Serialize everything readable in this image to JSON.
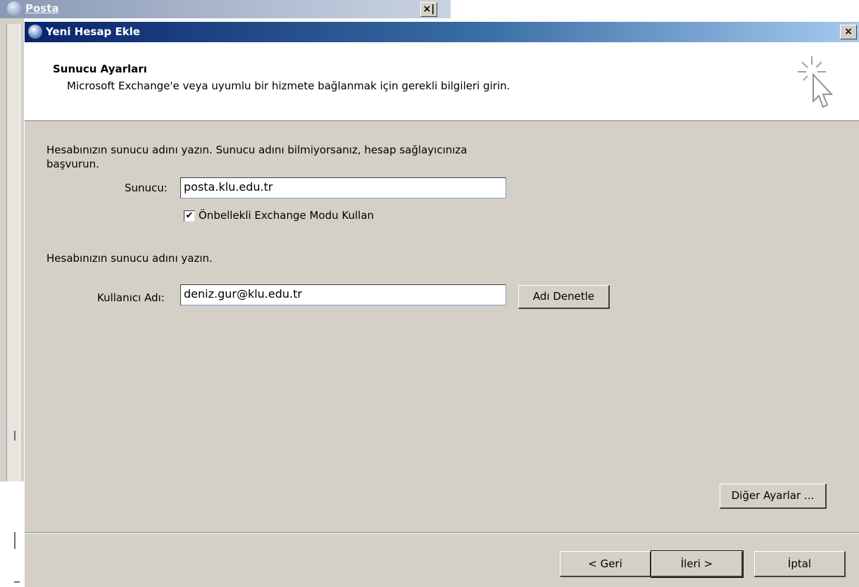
{
  "background_window": {
    "title": "Posta",
    "close_glyph": "×|"
  },
  "dialog": {
    "title": "Yeni Hesap Ekle",
    "close_glyph": "×",
    "header": {
      "title": "Sunucu Ayarları",
      "subtitle": "Microsoft Exchange'e veya uyumlu bir hizmete bağlanmak için gerekli bilgileri girin."
    },
    "server_section": {
      "instruction_line1": "Hesabınızın sunucu adını yazın. Sunucu adını bilmiyorsanız, hesap sağlayıcınıza",
      "instruction_line2": "başvurun.",
      "server_label": "Sunucu:",
      "server_value": "posta.klu.edu.tr",
      "cached_mode_label": "Önbellekli Exchange Modu Kullan",
      "cached_mode_checked": true
    },
    "user_section": {
      "instruction": "Hesabınızın sunucu adını yazın.",
      "username_label": "Kullanıcı Adı:",
      "username_value": "deniz.gur@klu.edu.tr",
      "check_name_button": "Adı Denetle"
    },
    "more_settings_button": "Diğer Ayarlar ...",
    "footer": {
      "back_button": "< Geri",
      "next_button": "İleri >",
      "cancel_button": "İptal"
    }
  },
  "icons": [
    "app-icon",
    "close-icon",
    "wizard-cursor-icon",
    "check-icon"
  ],
  "colors": {
    "titlebar_start": "#0a246a",
    "titlebar_end": "#a6caf0",
    "dialog_bg": "#d4d0c8"
  }
}
